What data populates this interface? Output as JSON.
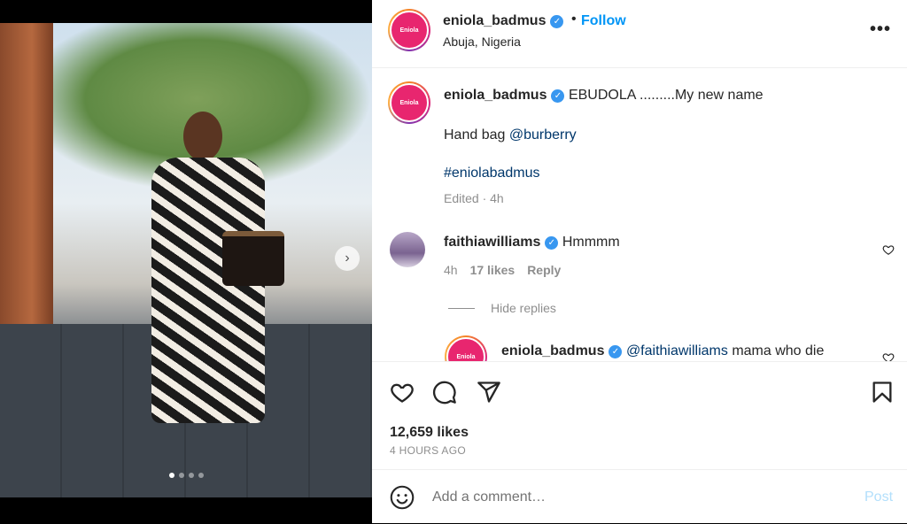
{
  "post": {
    "username": "eniola_badmus",
    "location": "Abuja, Nigeria",
    "follow_label": "Follow",
    "separator": "•",
    "more_label": "•••",
    "avatar_text": "Eniola",
    "carousel": {
      "slides": 4,
      "current": 1
    }
  },
  "caption": {
    "username": "eniola_badmus",
    "text": "EBUDOLA .........My new name",
    "line2_prefix": "Hand bag ",
    "line2_mention": "@burberry",
    "hashtag": "#eniolabadmus",
    "edited": "Edited · 4h"
  },
  "comments": [
    {
      "username": "faithiawilliams",
      "text": "Hmmmm",
      "time": "4h",
      "likes": "17 likes",
      "reply_label": "Reply"
    }
  ],
  "hide_replies_label": "Hide replies",
  "reply": {
    "username": "eniola_badmus",
    "mention": "@faithiawilliams",
    "text": "mama who die"
  },
  "stats": {
    "likes": "12,659 likes",
    "time": "4 HOURS AGO"
  },
  "composer": {
    "placeholder": "Add a comment…",
    "post_label": "Post"
  },
  "colors": {
    "accent": "#0095f6",
    "verified": "#3897f0",
    "muted": "#8e8e8e",
    "link": "#00376b"
  },
  "icons": [
    "verified-icon",
    "more-icon",
    "heart-icon",
    "comment-icon",
    "share-icon",
    "bookmark-icon",
    "emoji-icon",
    "next-arrow-icon"
  ]
}
